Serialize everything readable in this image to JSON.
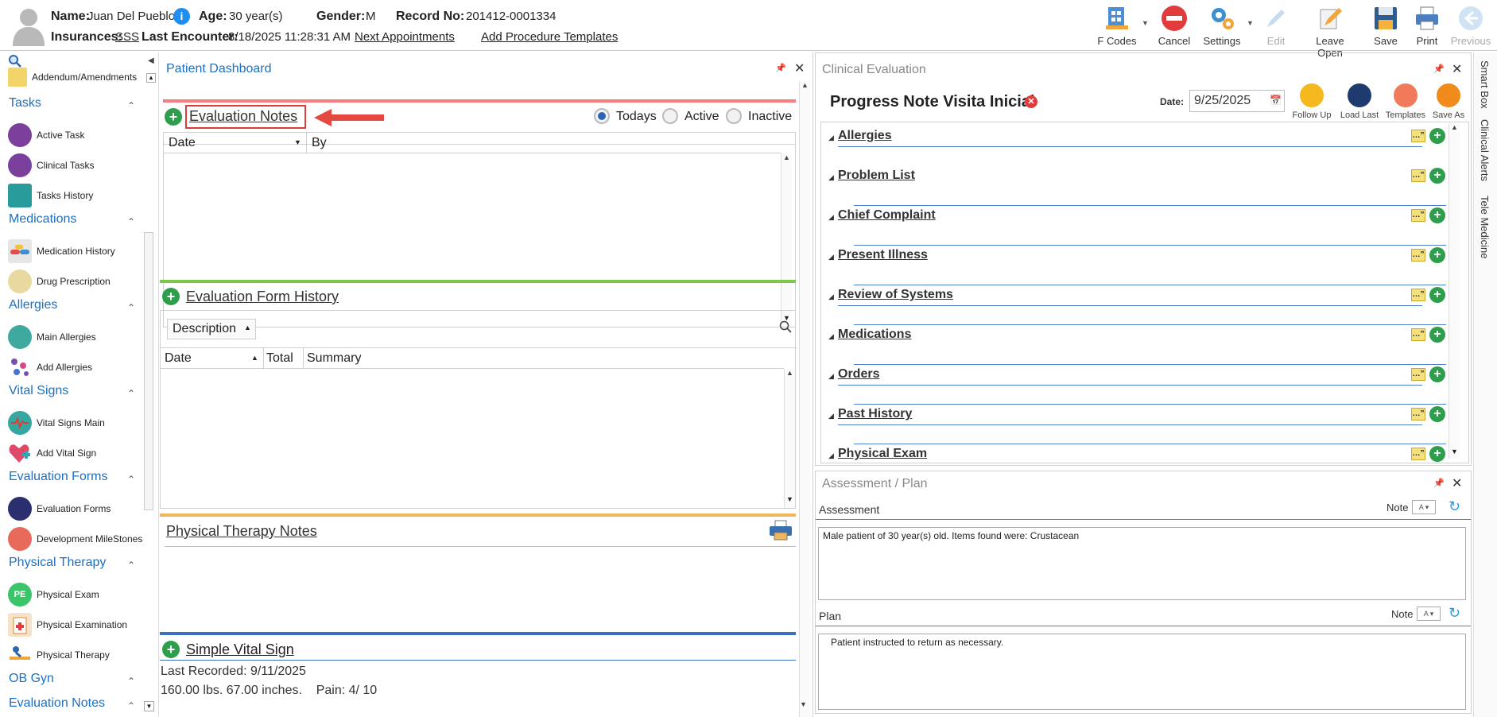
{
  "header": {
    "name_label": "Name:",
    "name": "Juan Del Pueblo",
    "age_label": "Age:",
    "age": "30 year(s)",
    "gender_label": "Gender:",
    "gender": "M",
    "record_label": "Record No:",
    "record": "201412-0001334",
    "insurances_label": "Insurances:",
    "insurance": "SSS",
    "last_encounter_label": "Last Encounter:",
    "last_encounter": "8/18/2025 11:28:31 AM",
    "next_appointments": "Next Appointments",
    "add_procedure_templates": "Add Procedure Templates"
  },
  "toolbar": {
    "fcodes": "F Codes",
    "cancel": "Cancel",
    "settings": "Settings",
    "edit": "Edit",
    "leave_open": "Leave Open",
    "save": "Save",
    "print": "Print",
    "previous": "Previous"
  },
  "sidebar": {
    "addendum": "Addendum/Amendments",
    "sections": {
      "tasks": "Tasks",
      "medications": "Medications",
      "allergies": "Allergies",
      "vital_signs": "Vital Signs",
      "evaluation_forms": "Evaluation Forms",
      "physical_therapy": "Physical Therapy",
      "ob_gyn": "OB Gyn",
      "evaluation_notes": "Evaluation Notes"
    },
    "items": {
      "active_task": "Active Task",
      "clinical_tasks": "Clinical Tasks",
      "tasks_history": "Tasks History",
      "medication_history": "Medication History",
      "drug_prescription": "Drug Prescription",
      "main_allergies": "Main Allergies",
      "add_allergies": "Add Allergies",
      "vital_signs_main": "Vital Signs Main",
      "add_vital_sign": "Add Vital Sign",
      "evaluation_forms": "Evaluation Forms",
      "development_milestones": "Development MileStones",
      "physical_exam": "Physical Exam",
      "physical_examination": "Physical Examination",
      "physical_therapy": "Physical Therapy"
    },
    "pe_badge": "PE"
  },
  "dashboard": {
    "title": "Patient Dashboard",
    "evaluation_notes": {
      "title": "Evaluation Notes",
      "filters": [
        "Todays",
        "Active",
        "Inactive"
      ],
      "selected_filter": "Todays",
      "columns": [
        "Date",
        "By"
      ]
    },
    "form_history": {
      "title": "Evaluation Form History",
      "group_by": "Description",
      "columns": [
        "Date",
        "Total",
        "Summary"
      ]
    },
    "pt_notes": {
      "title": "Physical Therapy Notes"
    },
    "vital": {
      "title": "Simple Vital Sign",
      "last_recorded": "Last Recorded: 9/11/2025",
      "values": "160.00 lbs. 67.00 inches.    Pain: 4/ 10"
    }
  },
  "clinical": {
    "panel_title": "Clinical Evaluation",
    "note_title": "Progress Note Visita Inicial",
    "date_label": "Date:",
    "date": "9/25/2025",
    "actions": [
      "Follow Up",
      "Load Last",
      "Templates",
      "Save As"
    ],
    "sections": [
      "Allergies",
      "Problem List",
      "Chief Complaint",
      "Present Illness",
      "Review of Systems",
      "Medications",
      "Orders",
      "Past History",
      "Physical Exam"
    ]
  },
  "assessment": {
    "panel_title": "Assessment / Plan",
    "assessment_label": "Assessment",
    "assessment_text": "Male patient of 30 year(s) old. Items found were:  Crustacean",
    "plan_label": "Plan",
    "plan_text": "Patient instructed to return as necessary.",
    "note_label": "Note"
  },
  "side_tabs": [
    "Smart Box",
    "Clinical Alerts",
    "Tele Medicine"
  ]
}
